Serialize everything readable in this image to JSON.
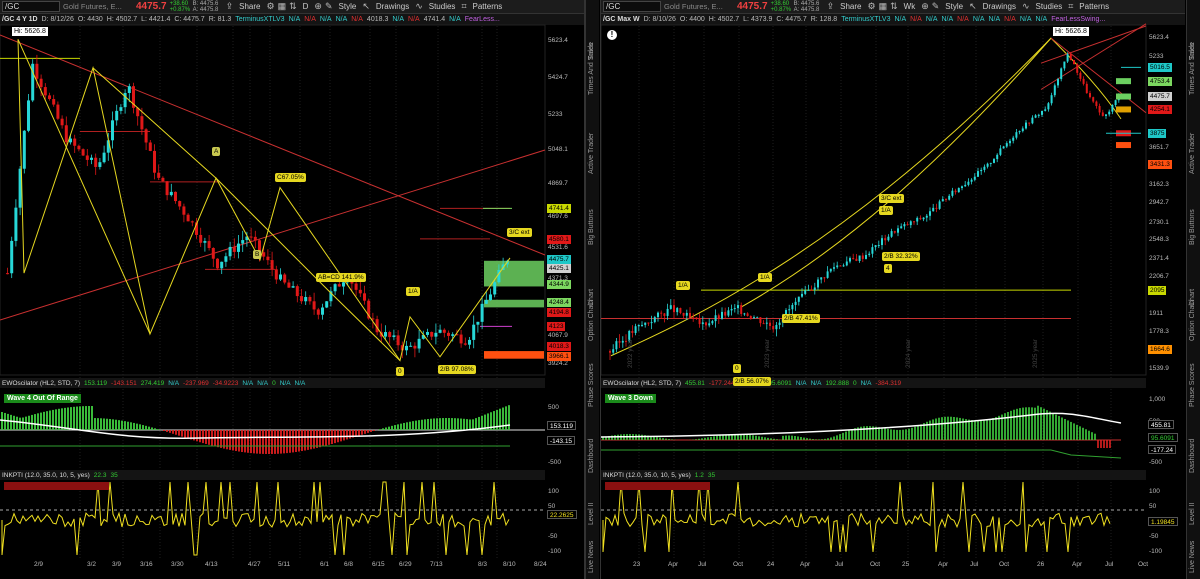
{
  "left": {
    "toolbar": {
      "symbol": "/GC",
      "name": "Gold Futures, E...",
      "price": "4475.7",
      "change1": "+38.60",
      "change2": "+0.87%",
      "bid": "B: 4475.6",
      "ask": "A: 4475.8",
      "share": "Share",
      "period": "D",
      "style": "Style",
      "drawings": "Drawings",
      "studies": "Studies",
      "patterns": "Patterns"
    },
    "status": [
      "/GC 4 Y 1D",
      "D: 8/12/26",
      "O: 4430",
      "H: 4502.7",
      "L: 4421.4",
      "C: 4475.7",
      "R: 81.3",
      "TerminusXTLV3",
      "N/A",
      "N/A",
      "N/A",
      "N/A",
      "N/A",
      "4018.3",
      "N/A",
      "N/A",
      "4741.4",
      "N/A",
      "FearLess..."
    ],
    "hi_label": "Hi: 5626.8",
    "price_axis": [
      "5623.4",
      "5424.7",
      "5233",
      "5048.1",
      "4869.7",
      "4697.6",
      "4531.6",
      "4371.3",
      "4067.9",
      "3924.2"
    ],
    "price_tags": [
      {
        "v": "4741.4",
        "c": "#c8d800"
      },
      {
        "v": "4580.1",
        "c": "#e01818"
      },
      {
        "v": "4475.7",
        "c": "#1ec8c8"
      },
      {
        "v": "4425.1",
        "c": "#d0d0d0"
      },
      {
        "v": "4344.9",
        "c": "#7cd860"
      },
      {
        "v": "4248.4",
        "c": "#7cd860"
      },
      {
        "v": "4194.8",
        "c": "#e01818"
      },
      {
        "v": "4123",
        "c": "#e01818"
      },
      {
        "v": "4018.3",
        "c": "#e01818"
      },
      {
        "v": "3966.1",
        "c": "#ff5010"
      }
    ],
    "wave_labels": [
      "A",
      "B",
      "C67.05%",
      "AB=CD 141.9%",
      "1/A",
      "3/C ext",
      "0",
      "2/B 97.08%"
    ],
    "dates": [
      "2/9",
      "3/2",
      "3/9",
      "3/16",
      "3/30",
      "4/13",
      "4/27",
      "5/11",
      "6/1",
      "6/8",
      "6/15",
      "6/29",
      "7/13",
      "8/3",
      "8/10",
      "8/24"
    ],
    "ewo": {
      "header": [
        "EWOscilator (HL2, STD, 7)",
        "153.119",
        "-143.151",
        "274.419",
        "N/A",
        "-237.969",
        "-34.9223",
        "N/A",
        "N/A",
        "0",
        "N/A",
        "N/A"
      ],
      "badge": "Wave 4  Out Of Range",
      "axis": [
        "500",
        "-500"
      ],
      "tags": [
        {
          "v": "153.119",
          "c": "#fff"
        },
        {
          "v": "-143.15",
          "c": "#fff"
        }
      ]
    },
    "inkpti": {
      "header": [
        "INKPTI (12.0, 35.0, 10, 5, yes)",
        "22.3",
        "35"
      ],
      "axis": [
        "100",
        "50",
        "-50",
        "-100"
      ],
      "tag": "22.2625"
    }
  },
  "right": {
    "toolbar": {
      "symbol": "/GC",
      "name": "Gold Futures, E...",
      "price": "4475.7",
      "change1": "+38.60",
      "change2": "+0.87%",
      "bid": "B: 4475.6",
      "ask": "A: 4475.8",
      "share": "Share",
      "period": "Wk",
      "style": "Style",
      "drawings": "Drawings",
      "studies": "Studies",
      "patterns": "Patterns"
    },
    "status": [
      "/GC Max W",
      "D: 8/10/26",
      "O: 4400",
      "H: 4502.7",
      "L: 4373.9",
      "C: 4475.7",
      "R: 128.8",
      "TerminusXTLV3",
      "N/A",
      "N/A",
      "N/A",
      "N/A",
      "N/A",
      "N/A",
      "N/A",
      "N/A",
      "N/A",
      "N/A",
      "FearLessSwing..."
    ],
    "hi_label": "Hi: 5626.8",
    "price_axis": [
      "5623.4",
      "5233",
      "4475.7",
      "3651.7",
      "3162.3",
      "2942.7",
      "2730.1",
      "2548.3",
      "2371.4",
      "2206.7",
      "1911",
      "1778.3",
      "1539.9"
    ],
    "price_tags": [
      {
        "v": "5016.5",
        "c": "#1ec8c8"
      },
      {
        "v": "4753.4",
        "c": "#7cd860"
      },
      {
        "v": "4475.7",
        "c": "#d0d0d0"
      },
      {
        "v": "4254.1",
        "c": "#e01818"
      },
      {
        "v": "3875",
        "c": "#1ec8c8"
      },
      {
        "v": "3431.3",
        "c": "#ff5010"
      },
      {
        "v": "2095",
        "c": "#c8d800"
      },
      {
        "v": "1664.6",
        "c": "#ff9000"
      }
    ],
    "wave_labels": [
      "1/A",
      "1/A",
      "3/C ext",
      "1/A",
      "2/B 32.32%",
      "4",
      "0",
      "2/B 56.07%",
      "2/B 47.41%"
    ],
    "year_labels": [
      "2022 year",
      "2023 year",
      "2024 year",
      "2025 year"
    ],
    "dates": [
      "23",
      "Apr",
      "Jul",
      "Oct",
      "24",
      "Apr",
      "Jul",
      "Oct",
      "25",
      "Apr",
      "Jul",
      "Oct",
      "26",
      "Apr",
      "Jul",
      "Oct"
    ],
    "ewo": {
      "header": [
        "EWOscilator (HL2, STD, 7)",
        "455.81",
        "-177.244",
        "-384.319",
        "95.6091",
        "N/A",
        "N/A",
        "192.888",
        "0",
        "N/A",
        "-384.319"
      ],
      "badge": "Wave 3 Down",
      "axis": [
        "1,000",
        "500",
        "-500"
      ],
      "tags": [
        {
          "v": "455.81",
          "c": "#fff"
        },
        {
          "v": "95.6091",
          "c": "#3c3"
        },
        {
          "v": "-177.24",
          "c": "#fff"
        }
      ]
    },
    "inkpti": {
      "header": [
        "INKPTI (12.0, 35.0, 10, 5, yes)",
        "1.2",
        "35"
      ],
      "axis": [
        "100",
        "50",
        "-50",
        "-100"
      ],
      "tag": "1.19845"
    }
  },
  "sidebar": [
    "Trade",
    "Times And Sales",
    "Active Trader",
    "Big Buttons",
    "Chart",
    "Option Chain",
    "Phase Scores",
    "Dashboard",
    "Level II",
    "Live News"
  ]
}
